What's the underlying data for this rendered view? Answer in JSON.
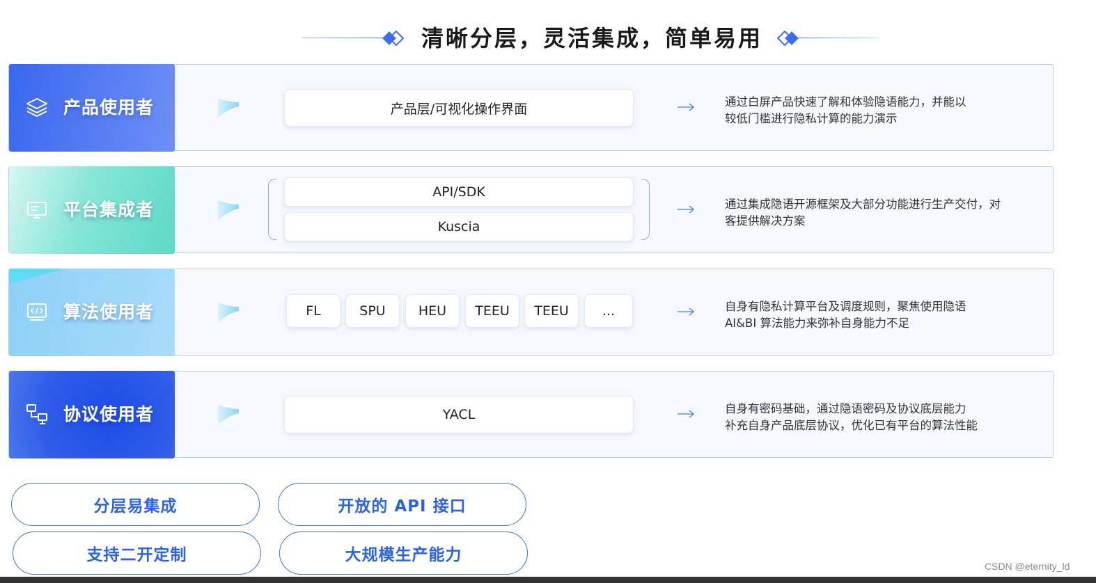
{
  "title": "清晰分层，灵活集成，简单易用",
  "rows": [
    {
      "role": "产品使用者",
      "icon": "layers-icon",
      "boxes": [
        "产品层/可视化操作界面"
      ],
      "description_lines": [
        "通过白屏产品快速了解和体验隐语能力，并能以",
        "较低门槛进行隐私计算的能力演示"
      ]
    },
    {
      "role": "平台集成者",
      "icon": "monitor-icon",
      "boxes": [
        "API/SDK",
        "Kuscia"
      ],
      "description_lines": [
        "通过集成隐语开源框架及大部分功能进行生产交付，对",
        "客提供解决方案"
      ]
    },
    {
      "role": "算法使用者",
      "icon": "code-window-icon",
      "boxes": [
        "FL",
        "SPU",
        "HEU",
        "TEEU",
        "TEEU",
        "..."
      ],
      "description_lines": [
        "自身有隐私计算平台及调度规则，聚焦使用隐语",
        "AI&BI 算法能力来弥补自身能力不足"
      ]
    },
    {
      "role": "协议使用者",
      "icon": "network-icon",
      "boxes": [
        "YACL"
      ],
      "description_lines": [
        "自身有密码基础，通过隐语密码及协议底层能力",
        "补充自身产品底层协议，优化已有平台的算法性能"
      ]
    }
  ],
  "features": [
    "分层易集成",
    "开放的 API 接口",
    "支持二开定制",
    "大规模生产能力"
  ],
  "watermark": "CSDN @eternity_ld",
  "colors": {
    "accent": "#3b6ee8",
    "row_border": "#b8cdf3",
    "row_bg": "#f6f8fd",
    "role1": "#3a67f0",
    "role2": "#5cd9c8",
    "role3": "#8fd0f8",
    "role4": "#1e4de6"
  }
}
